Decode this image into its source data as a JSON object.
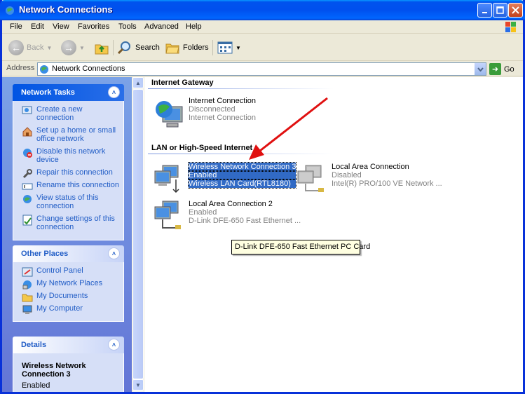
{
  "window": {
    "title": "Network Connections"
  },
  "menu": [
    "File",
    "Edit",
    "View",
    "Favorites",
    "Tools",
    "Advanced",
    "Help"
  ],
  "toolbar": {
    "back": "Back",
    "search": "Search",
    "folders": "Folders"
  },
  "address": {
    "label": "Address",
    "value": "Network Connections",
    "go": "Go"
  },
  "network_tasks": {
    "title": "Network Tasks",
    "items": [
      {
        "label": "Create a new connection",
        "icon": "new-connection-icon"
      },
      {
        "label": "Set up a home or small office network",
        "icon": "home-network-icon"
      },
      {
        "label": "Disable this network device",
        "icon": "disable-icon"
      },
      {
        "label": "Repair this connection",
        "icon": "repair-icon"
      },
      {
        "label": "Rename this connection",
        "icon": "rename-icon"
      },
      {
        "label": "View status of this connection",
        "icon": "status-icon"
      },
      {
        "label": "Change settings of this connection",
        "icon": "settings-icon"
      }
    ]
  },
  "other_places": {
    "title": "Other Places",
    "items": [
      {
        "label": "Control Panel"
      },
      {
        "label": "My Network Places"
      },
      {
        "label": "My Documents"
      },
      {
        "label": "My Computer"
      }
    ]
  },
  "details": {
    "title": "Details",
    "name": "Wireless Network Connection 3",
    "status": "Enabled"
  },
  "groups": {
    "gateway": "Internet Gateway",
    "lan": "LAN or High-Speed Internet"
  },
  "connections": {
    "internet": {
      "name": "Internet Connection",
      "status": "Disconnected",
      "device": "Internet Connection"
    },
    "wireless": {
      "name": "Wireless Network Connection 3",
      "status": "Enabled",
      "device": "Wireless LAN Card(RTL8180)"
    },
    "lan": {
      "name": "Local Area Connection",
      "status": "Disabled",
      "device": "Intel(R) PRO/100 VE Network ..."
    },
    "lan2": {
      "name": "Local Area Connection 2",
      "status": "Enabled",
      "device": "D-Link DFE-650 Fast Ethernet ..."
    }
  },
  "tooltip": "D-Link DFE-650 Fast Ethernet PC Card",
  "colors": {
    "accent": "#316ac5",
    "annotation_arrow": "#e01010",
    "title_bar": "#0053ee"
  }
}
